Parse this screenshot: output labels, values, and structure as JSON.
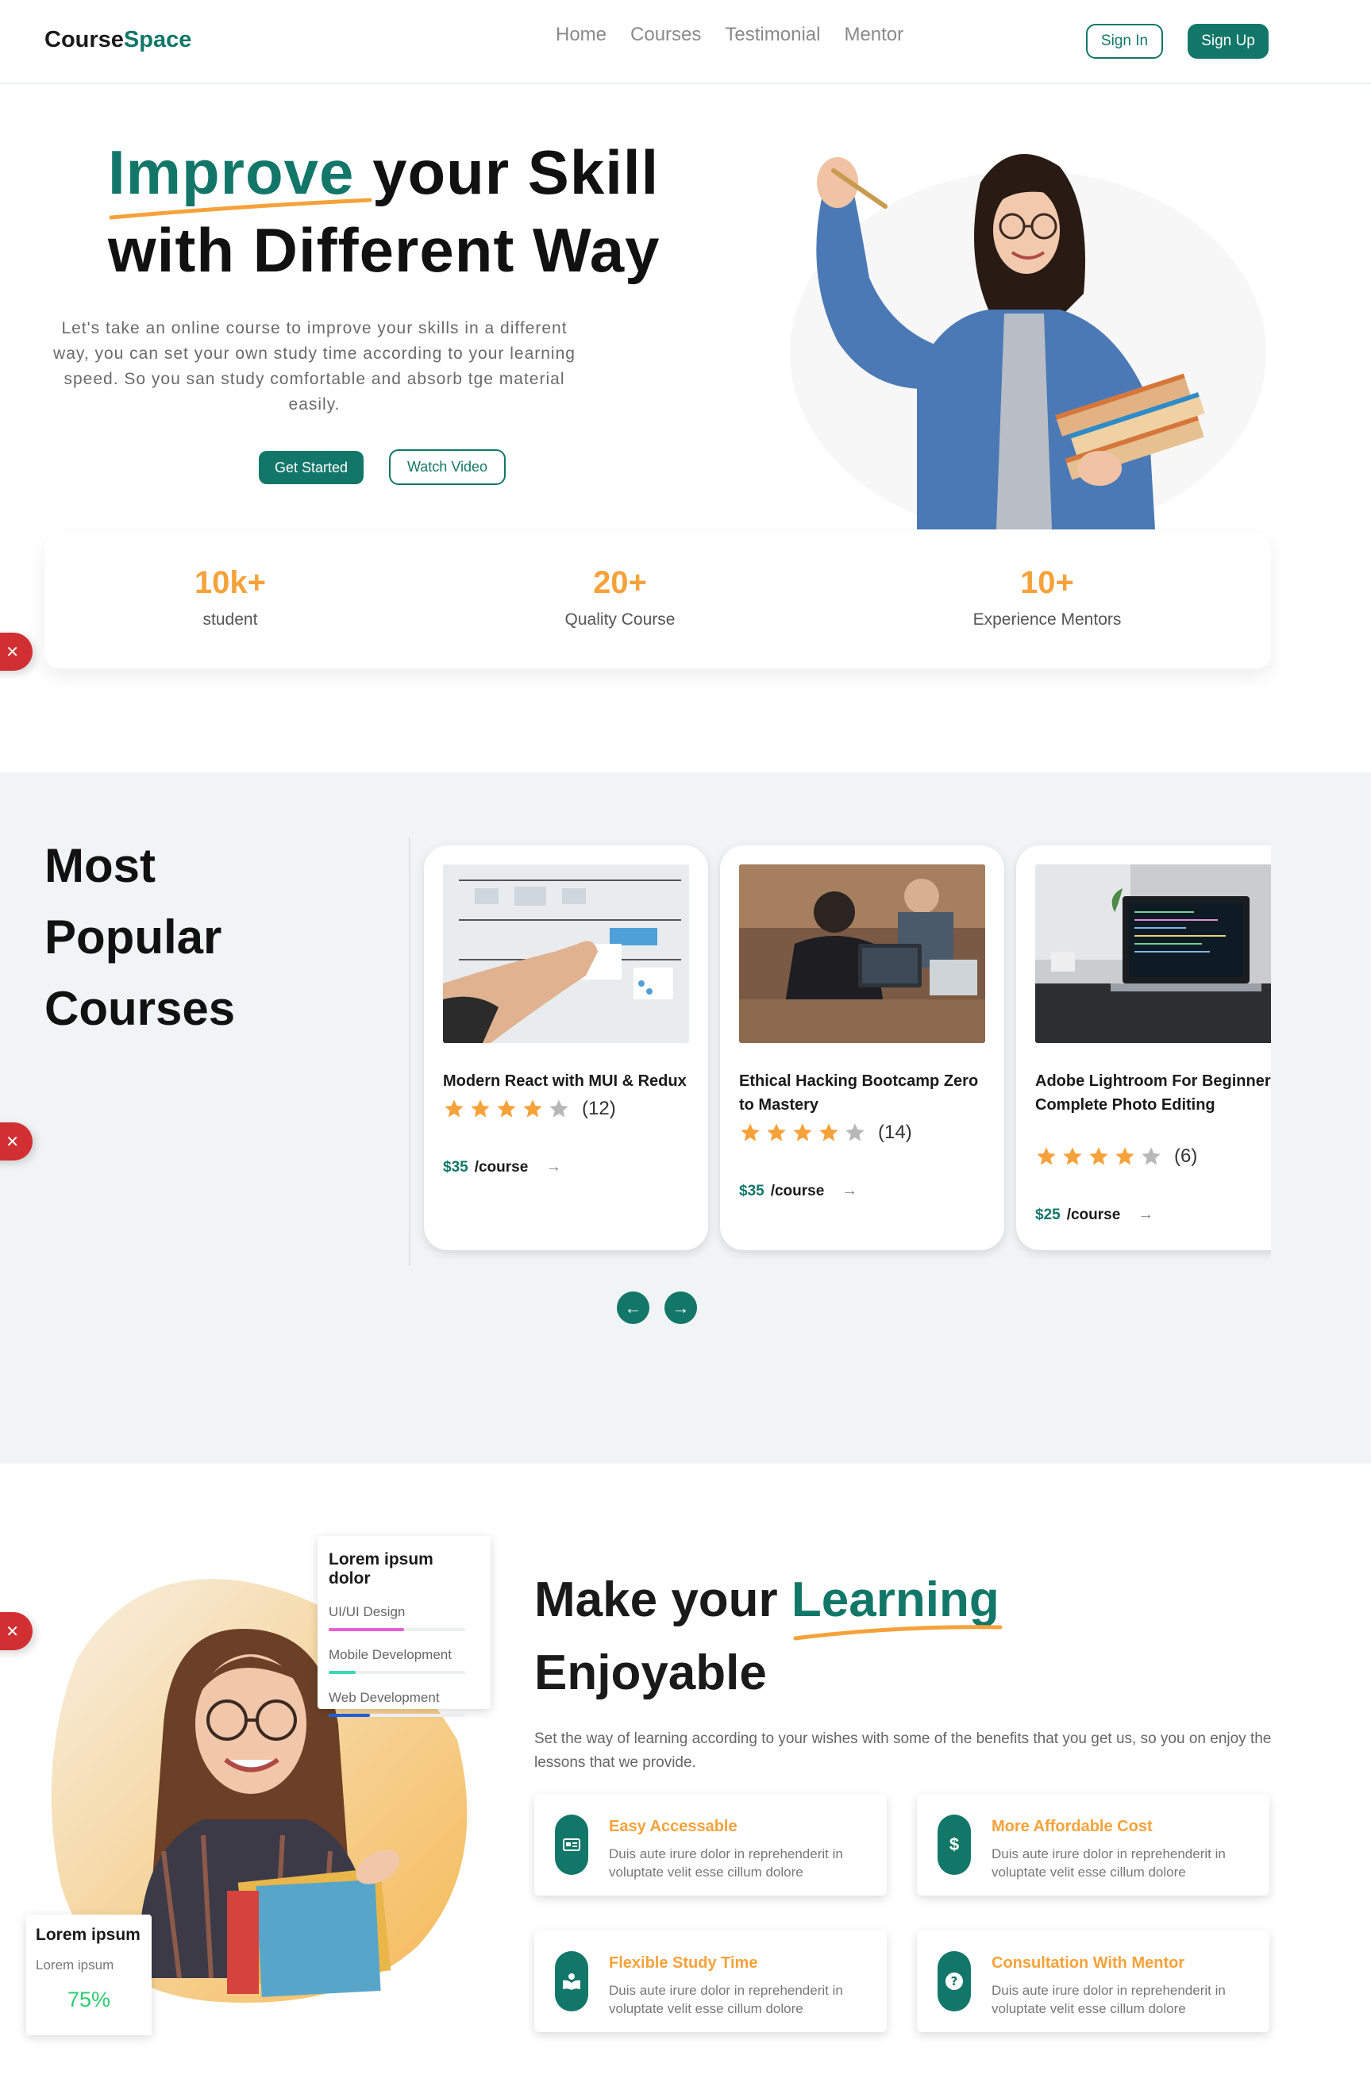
{
  "header": {
    "logo_main": "Course",
    "logo_accent": "Space",
    "nav": [
      "Home",
      "Courses",
      "Testimonial",
      "Mentor"
    ],
    "signin": "Sign In",
    "signup": "Sign Up"
  },
  "hero": {
    "title_green": "Improve",
    "title_rest1": " your Skill",
    "title_line2": "with Different Way",
    "description": "Let's take an online course to improve your skills in a different way, you can set your own study time according to your learning speed. So you san study comfortable and absorb tge material easily.",
    "get_started": "Get Started",
    "watch_video": "Watch Video"
  },
  "stats": [
    {
      "num": "10k+",
      "label": "student"
    },
    {
      "num": "20+",
      "label": "Quality Course"
    },
    {
      "num": "10+",
      "label": "Experience Mentors"
    }
  ],
  "close_glyph": "✕",
  "popular": {
    "title_lines": [
      "Most",
      "Popular",
      "Courses"
    ],
    "prev": "←",
    "next": "→",
    "courses": [
      {
        "title": "Modern React with MUI & Redux",
        "rating": 4,
        "count": "(12)",
        "price": "$35",
        "unit": "/course",
        "arrow": "→"
      },
      {
        "title": "Ethical Hacking Bootcamp Zero to Mastery",
        "rating": 4,
        "count": "(14)",
        "price": "$35",
        "unit": "/course",
        "arrow": "→"
      },
      {
        "title": "Adobe Lightroom For Beginners: Complete Photo Editing",
        "rating": 4,
        "count": "(6)",
        "price": "$25",
        "unit": "/course",
        "arrow": "→"
      }
    ]
  },
  "learning": {
    "popup_title": "Lorem ipsum dolor",
    "popup_items": [
      {
        "label": "UI/UI Design",
        "progress": 0.55,
        "color": "#e55fd6"
      },
      {
        "label": "Mobile Development",
        "progress": 0.2,
        "color": "#3dd6b7"
      },
      {
        "label": "Web Development",
        "progress": 0.3,
        "color": "#1d5fd6"
      }
    ],
    "small_title": "Lorem ipsum",
    "small_sub": "Lorem ipsum",
    "small_pct": "75%",
    "title_part1": "Make your ",
    "title_green": "Learning",
    "title_line2": "Enjoyable",
    "description": "Set the way of learning according to your wishes with some of the benefits that you get us, so you on enjoy the lessons that we provide.",
    "features": [
      {
        "title": "Easy Accessable",
        "desc": "Duis aute irure dolor in reprehenderit in voluptate velit esse cillum dolore",
        "icon": "id-card-icon"
      },
      {
        "title": "More Affordable Cost",
        "desc": "Duis aute irure dolor in reprehenderit in voluptate velit esse cillum dolore",
        "icon": "dollar-icon"
      },
      {
        "title": "Flexible Study Time",
        "desc": "Duis aute irure dolor in reprehenderit in voluptate velit esse cillum dolore",
        "icon": "book-reader-icon"
      },
      {
        "title": "Consultation With Mentor",
        "desc": "Duis aute irure dolor in reprehenderit in voluptate velit esse cillum dolore",
        "icon": "question-icon"
      }
    ]
  },
  "colors": {
    "primary": "#127769",
    "accent": "#f5a23a",
    "danger": "#d22f33",
    "section_bg": "#f1f4f5"
  }
}
